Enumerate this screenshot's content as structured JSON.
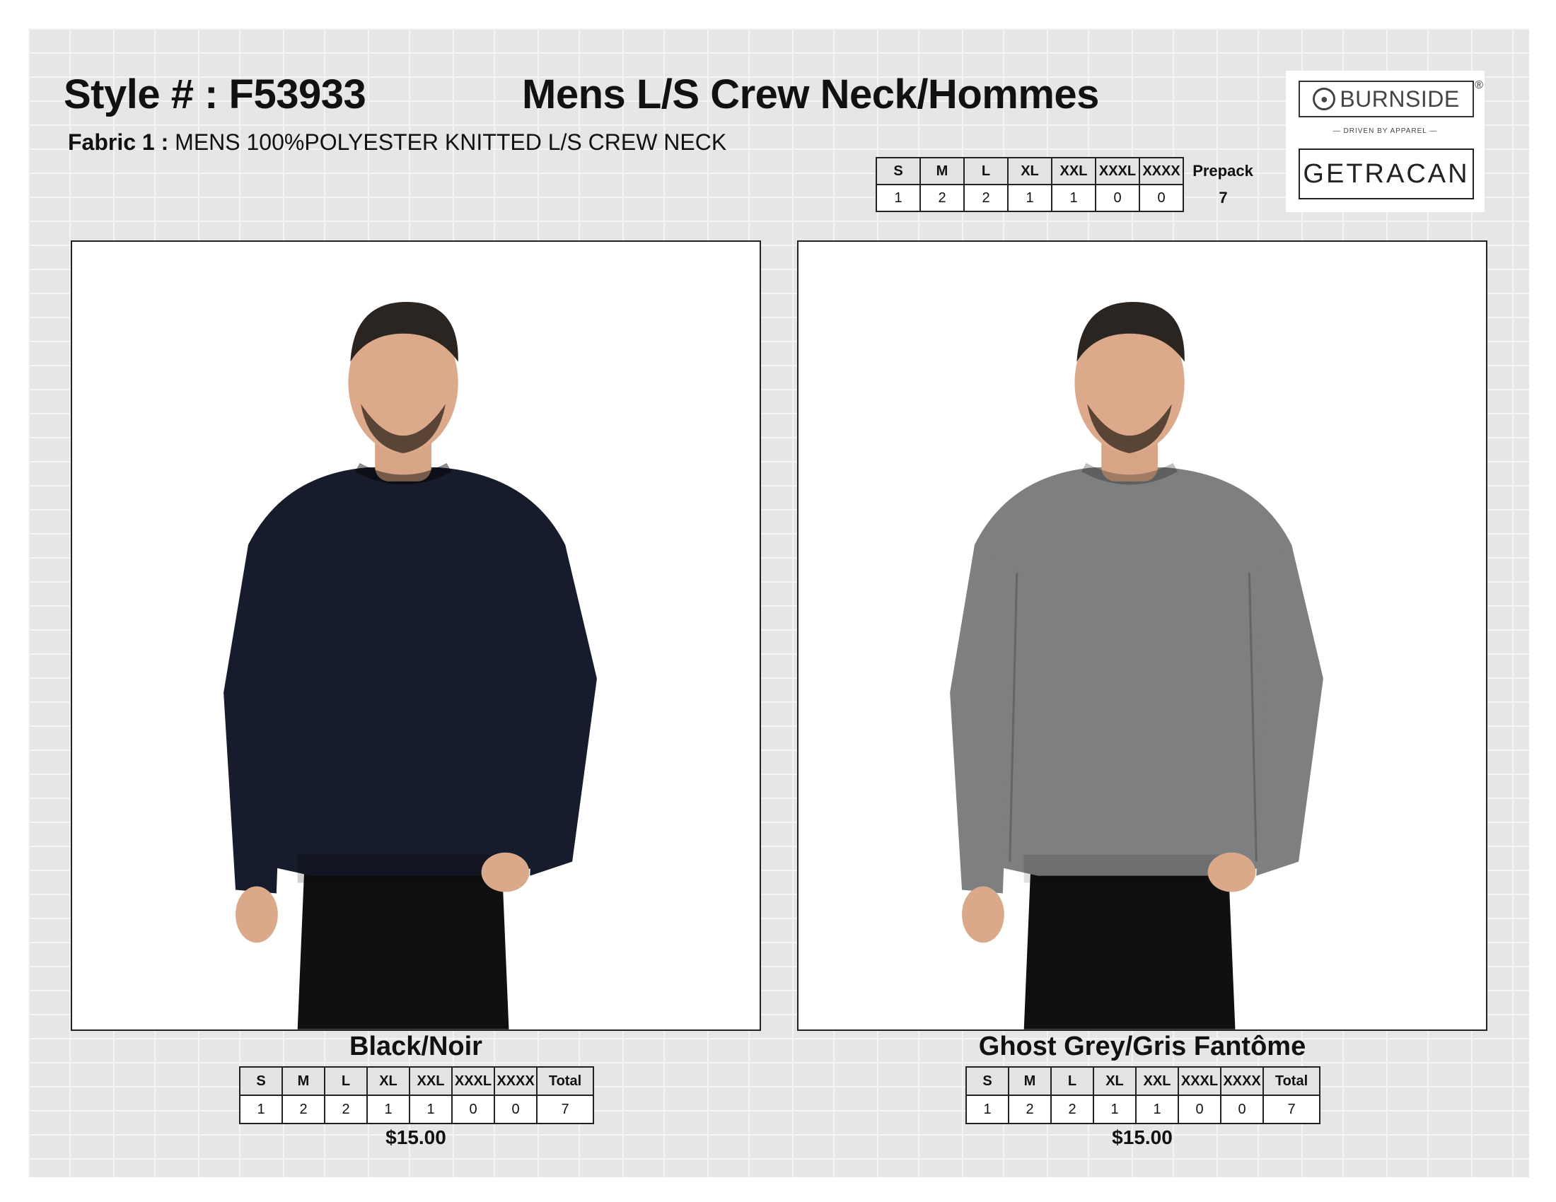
{
  "header": {
    "style_label": "Style # : F53933",
    "title": "Mens L/S Crew Neck/Hommes",
    "fabric_label": "Fabric 1 :",
    "fabric_value": " MENS 100%POLYESTER KNITTED L/S CREW NECK"
  },
  "prepack": {
    "sizes": [
      "S",
      "M",
      "L",
      "XL",
      "XXL",
      "XXXL",
      "XXXX"
    ],
    "qty": [
      "1",
      "2",
      "2",
      "1",
      "1",
      "0",
      "0"
    ],
    "label": "Prepack",
    "total": "7"
  },
  "logo": {
    "brand": "BURNSIDE",
    "registered": "®",
    "tagline": "— DRIVEN BY APPAREL —",
    "company": "GETRACAN"
  },
  "products": [
    {
      "color_name": "Black/Noir",
      "sweater_color": "#161c2b",
      "sizes": [
        "S",
        "M",
        "L",
        "XL",
        "XXL",
        "XXXL",
        "XXXX"
      ],
      "qty": [
        "1",
        "2",
        "2",
        "1",
        "1",
        "0",
        "0"
      ],
      "total_label": "Total",
      "total": "7",
      "price": "$15.00"
    },
    {
      "color_name": "Ghost Grey/Gris Fantôme",
      "sweater_color": "#7d7f80",
      "sizes": [
        "S",
        "M",
        "L",
        "XL",
        "XXL",
        "XXXL",
        "XXXX"
      ],
      "qty": [
        "1",
        "2",
        "2",
        "1",
        "1",
        "0",
        "0"
      ],
      "total_label": "Total",
      "total": "7",
      "price": "$15.00"
    }
  ]
}
